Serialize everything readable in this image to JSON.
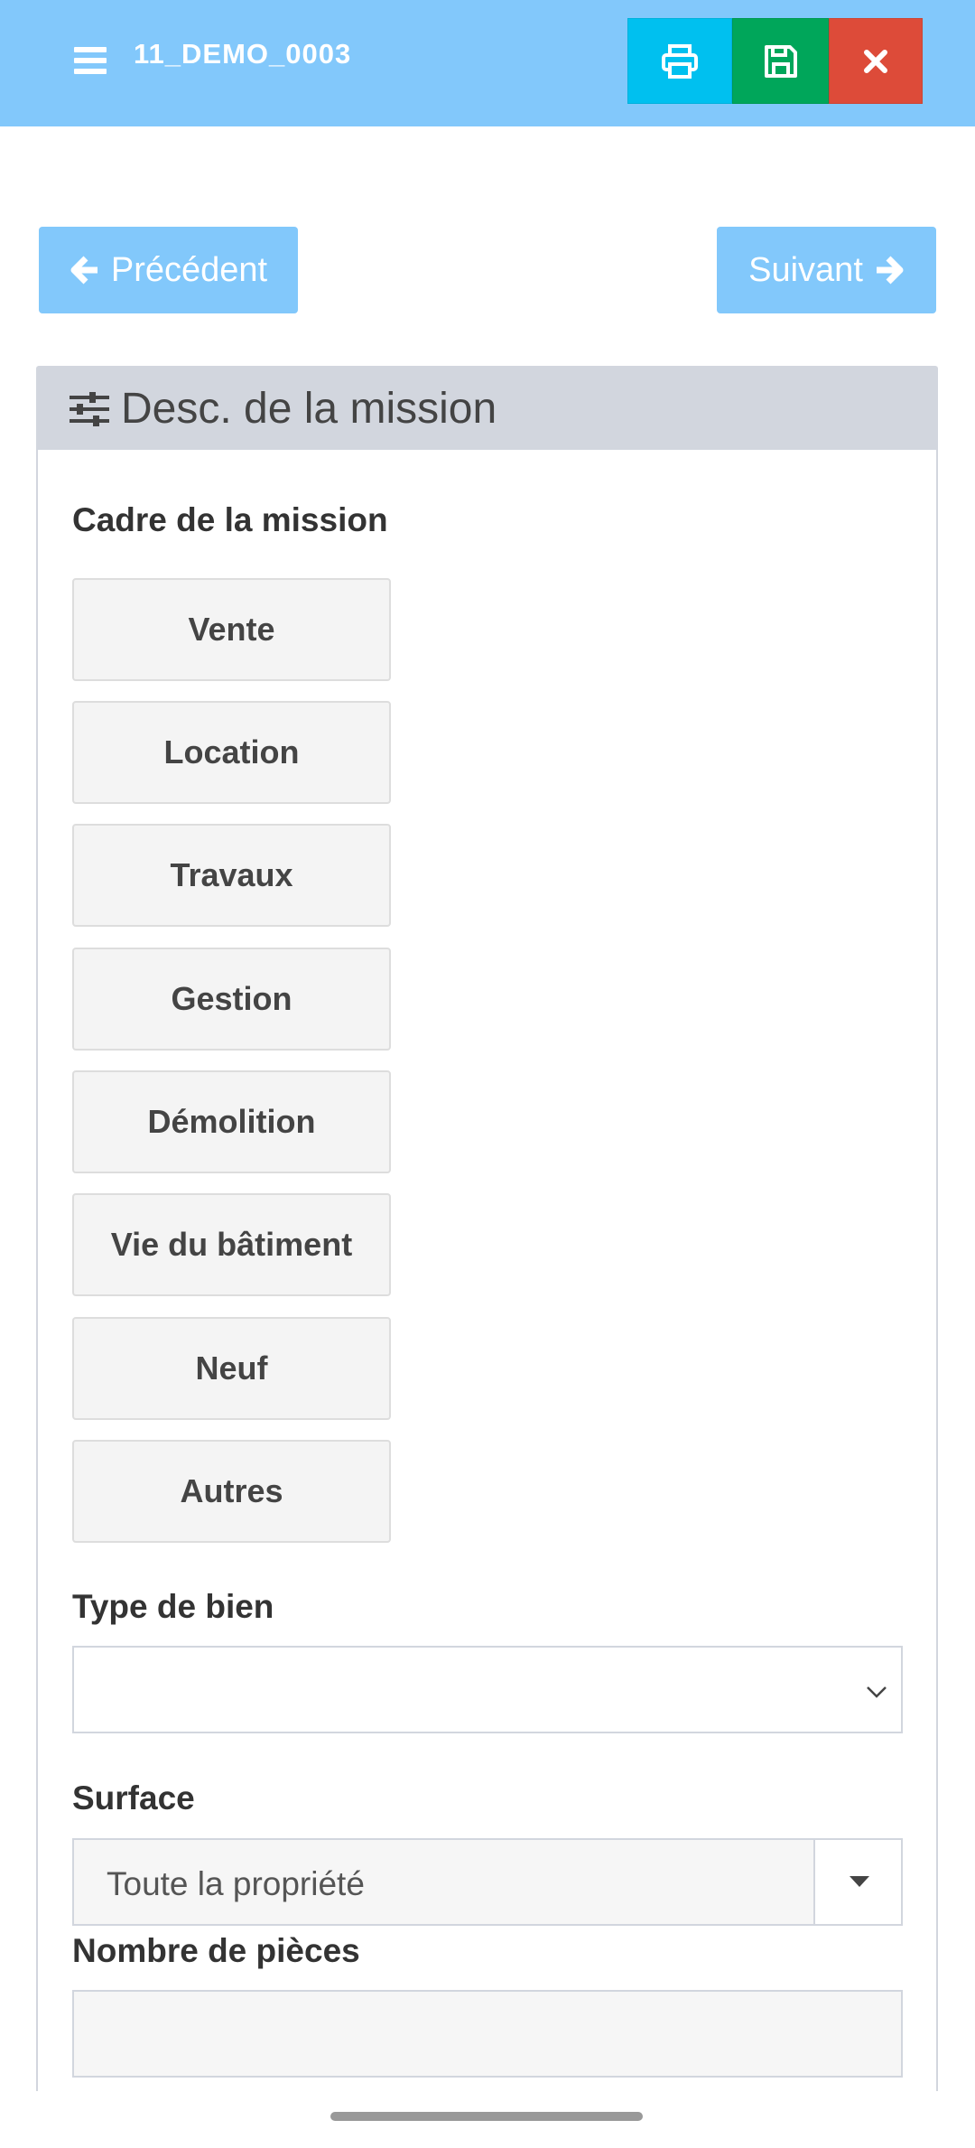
{
  "header": {
    "title": "11_DEMO_0003",
    "icons": {
      "menu": "hamburger-icon",
      "print": "printer-icon",
      "save": "floppy-disk-icon",
      "close": "close-x-icon"
    },
    "colors": {
      "bar": "#82c8fb",
      "print": "#00c0ef",
      "save": "#00a65a",
      "close": "#dd4b39"
    }
  },
  "nav": {
    "prev_label": "Précédent",
    "next_label": "Suivant"
  },
  "panel": {
    "title": "Desc. de la mission",
    "icon": "sliders-icon"
  },
  "form": {
    "cadre_label": "Cadre de la mission",
    "cadre_options": [
      "Vente",
      "Location",
      "Travaux",
      "Gestion",
      "Démolition",
      "Vie du bâtiment",
      "Neuf",
      "Autres"
    ],
    "type_bien_label": "Type de bien",
    "type_bien_value": "",
    "surface_label": "Surface",
    "surface_value": "Toute la propriété",
    "pieces_label": "Nombre de pièces",
    "pieces_value": ""
  }
}
